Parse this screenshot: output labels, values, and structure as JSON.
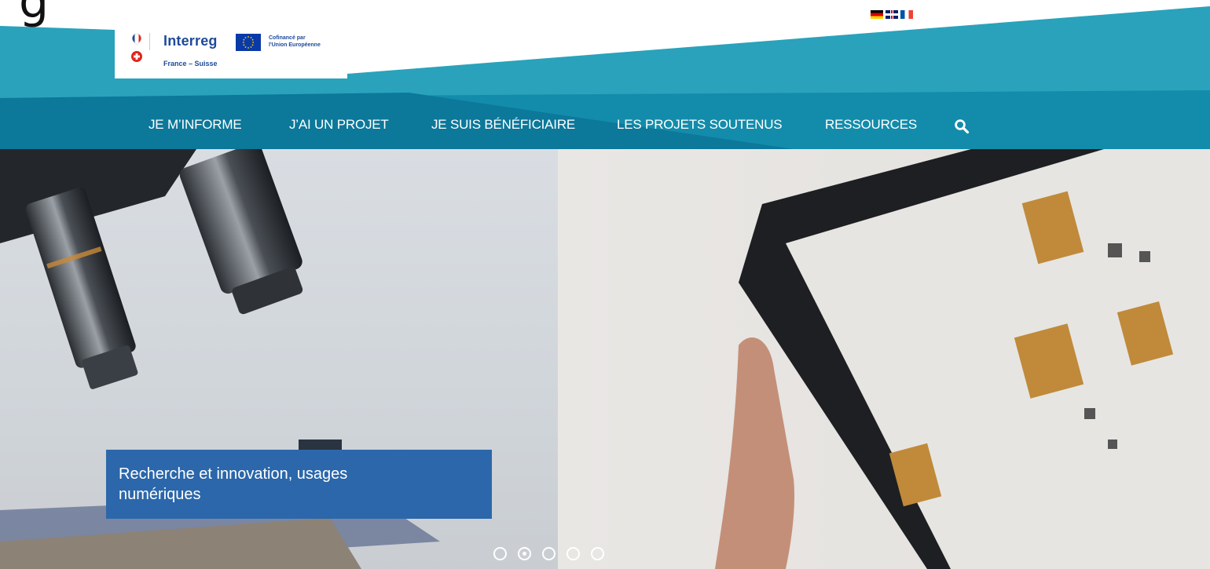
{
  "header": {
    "languages": [
      {
        "code": "de",
        "icon": "german-flag-icon"
      },
      {
        "code": "en",
        "icon": "uk-flag-icon"
      },
      {
        "code": "fr",
        "icon": "french-flag-icon"
      }
    ],
    "band_colors": {
      "light": "#2aa2bb",
      "mid": "#138cab",
      "dark": "#0c789a"
    }
  },
  "logo": {
    "brand": "Interreg",
    "eu_line1": "Cofinancé par",
    "eu_line2": "l'Union Européenne",
    "subtitle": "France – Suisse"
  },
  "nav": {
    "items": [
      {
        "label": "JE M’INFORME"
      },
      {
        "label": "J’AI UN PROJET"
      },
      {
        "label": "JE SUIS BÉNÉFICIAIRE"
      },
      {
        "label": "LES PROJETS SOUTENUS"
      },
      {
        "label": "RESSOURCES"
      }
    ],
    "search_icon": "search-icon"
  },
  "hero": {
    "caption": "Recherche et innovation, usages numériques",
    "caption_color": "#2b67aa",
    "slides_total": 5,
    "active_slide": 2
  }
}
